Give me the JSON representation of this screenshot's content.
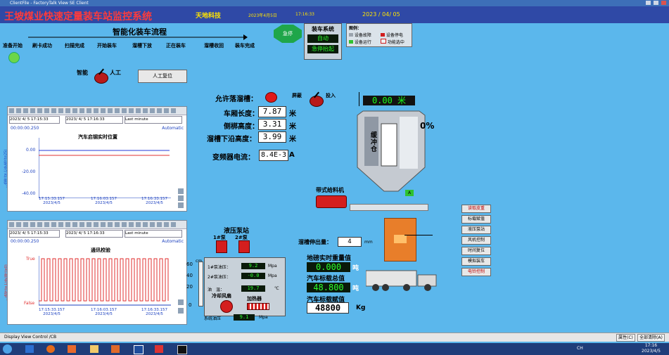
{
  "window": {
    "title": "ClientFile - FactoryTalk View SE Client"
  },
  "header": {
    "main_title": "王坡煤业快速定量装车站监控系统",
    "company": "天地科技",
    "date_small": "2023年4月5日",
    "time_small": "17:16:33",
    "date_large": "2023 / 04/ 05"
  },
  "process": {
    "title": "智能化装车流程",
    "steps": [
      "准备开始",
      "刷卡成功",
      "扫描完成",
      "开始装车",
      "溜槽下放",
      "正在装车",
      "溜槽收回",
      "装车完成"
    ]
  },
  "estop": {
    "label": "急停"
  },
  "loading_system": {
    "title": "装车系统",
    "mode": "自动",
    "estop_status": "急停抬起"
  },
  "legend": {
    "title": "图例：",
    "items": [
      {
        "label": "设备故障",
        "color": "#9aa3ad"
      },
      {
        "label": "设备停电",
        "color": "#d11e1e"
      },
      {
        "label": "设备运行",
        "color": "#2fc22f"
      },
      {
        "label": "功能选中",
        "color": "#f0f0f0"
      }
    ]
  },
  "mode_switch": {
    "left_label": "智能",
    "right_label": "人工",
    "reset_button": "人工复位"
  },
  "trend1": {
    "start_time": "2023/ 4/ 5 17:15:33",
    "end_time": "2023/ 4/ 5 17:16:33",
    "range": "Last minute",
    "span": "00:00:00.250",
    "scale_mode": "Automatic",
    "title": "汽车启钢实时位置",
    "y_axis_label": "...dWrite.LiduWrite25)",
    "y_ticks": [
      "0.00",
      "-20.00",
      "-40.00"
    ],
    "x_ticks": [
      {
        "time": "17:15:33.157",
        "date": "2023/4/5"
      },
      {
        "time": "17:16:03.157",
        "date": "2023/4/5"
      },
      {
        "time": "17:16:33.157",
        "date": "2023/4/5"
      }
    ]
  },
  "trend2": {
    "start_time": "2023/ 4/ 5 17:15:33",
    "end_time": "2023/ 4/ 5 17:16:33",
    "range": "Last minute",
    "span": "00:00:00.250",
    "scale_mode": "Automatic",
    "title": "通讯校验",
    "y_axis_label": "...dWrite.LiduWrite0)",
    "y_ticks": [
      "True",
      "False"
    ],
    "x_ticks": [
      {
        "time": "17:15:33.157",
        "date": "2023/4/5"
      },
      {
        "time": "17:16:03.157",
        "date": "2023/4/5"
      },
      {
        "time": "17:16:33.157",
        "date": "2023/4/5"
      }
    ]
  },
  "chute": {
    "allow_label": "允许落溜槽：",
    "shield_label": "屏蔽",
    "input_label": "投入",
    "car_length_label": "车厢长度：",
    "car_length": "7.87",
    "side_height_label": "侧梆高度：",
    "side_height": "3.31",
    "chute_bottom_label": "溜槽下沿高度：",
    "chute_bottom": "3.99",
    "unit_m": "米",
    "vfd_label": "变频器电流：",
    "vfd_current": "8.4E-3",
    "vfd_unit": "A"
  },
  "bin": {
    "reading": "0.00 米",
    "percent": "0%",
    "label": "缓冲仓",
    "marker": "A"
  },
  "feeder": {
    "label": "带式给料机"
  },
  "hydraulic": {
    "title": "液压泵站",
    "pump1": "1#泵",
    "pump2": "2#泵",
    "gauge_ticks": [
      "60",
      "40",
      "20",
      "0"
    ],
    "gauge_unit": "cm",
    "p1_label": "1#泵油压：",
    "p1_value": "9.2",
    "p2_label": "2#泵油压：",
    "p2_value": "-0.0",
    "unit_mpa": "Mpa",
    "oil_temp_label": "油　温：",
    "oil_temp": "19.7",
    "temp_unit": "℃",
    "fan_label": "冷却风扇",
    "heater_label": "加热器",
    "sys_pressure_label": "系统油压",
    "sys_pressure": "9.1"
  },
  "chute_ext": {
    "label": "溜槽伸出量：",
    "value": "4",
    "unit": "mm"
  },
  "weights": {
    "scale_label": "地磅实时重量值",
    "scale_value": "0.000",
    "unit_t": "吨",
    "total_label": "汽车标载总值",
    "total_value": "48.800",
    "set_label": "汽车标载赋值",
    "set_value": "48800",
    "set_unit": "Kg"
  },
  "side_buttons": [
    "读取皮重",
    "标载赋值",
    "液压泵站",
    "风机控制",
    "时间复位",
    "模拟装车",
    "电铃控制"
  ],
  "status_bar": {
    "left": "Display View Control /CB",
    "btn1": "属性(C)",
    "btn2": "全部清除(A)"
  },
  "taskbar": {
    "time": "17:16",
    "date": "2023/4/5",
    "tray_text": "CH"
  }
}
